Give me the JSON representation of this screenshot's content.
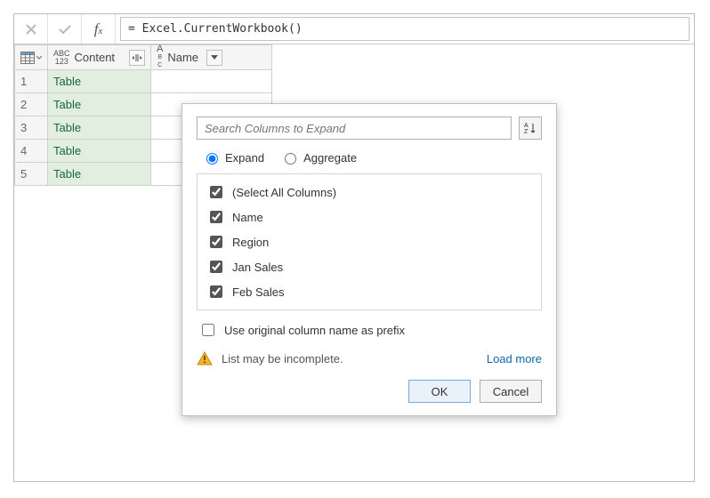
{
  "formula_bar": {
    "formula": "= Excel.CurrentWorkbook()"
  },
  "columns": {
    "content": {
      "label": "Content"
    },
    "name": {
      "label": "Name"
    }
  },
  "rows": [
    {
      "n": "1",
      "content": "Table",
      "name": ""
    },
    {
      "n": "2",
      "content": "Table",
      "name": ""
    },
    {
      "n": "3",
      "content": "Table",
      "name": ""
    },
    {
      "n": "4",
      "content": "Table",
      "name": ""
    },
    {
      "n": "5",
      "content": "Table",
      "name": ""
    }
  ],
  "popup": {
    "search_placeholder": "Search Columns to Expand",
    "mode_expand": "Expand",
    "mode_aggregate": "Aggregate",
    "select_all": "(Select All Columns)",
    "cols": {
      "c1": "Name",
      "c2": "Region",
      "c3": "Jan Sales",
      "c4": "Feb Sales"
    },
    "prefix_label": "Use original column name as prefix",
    "warn_text": "List may be incomplete.",
    "load_more": "Load more",
    "ok": "OK",
    "cancel": "Cancel"
  }
}
